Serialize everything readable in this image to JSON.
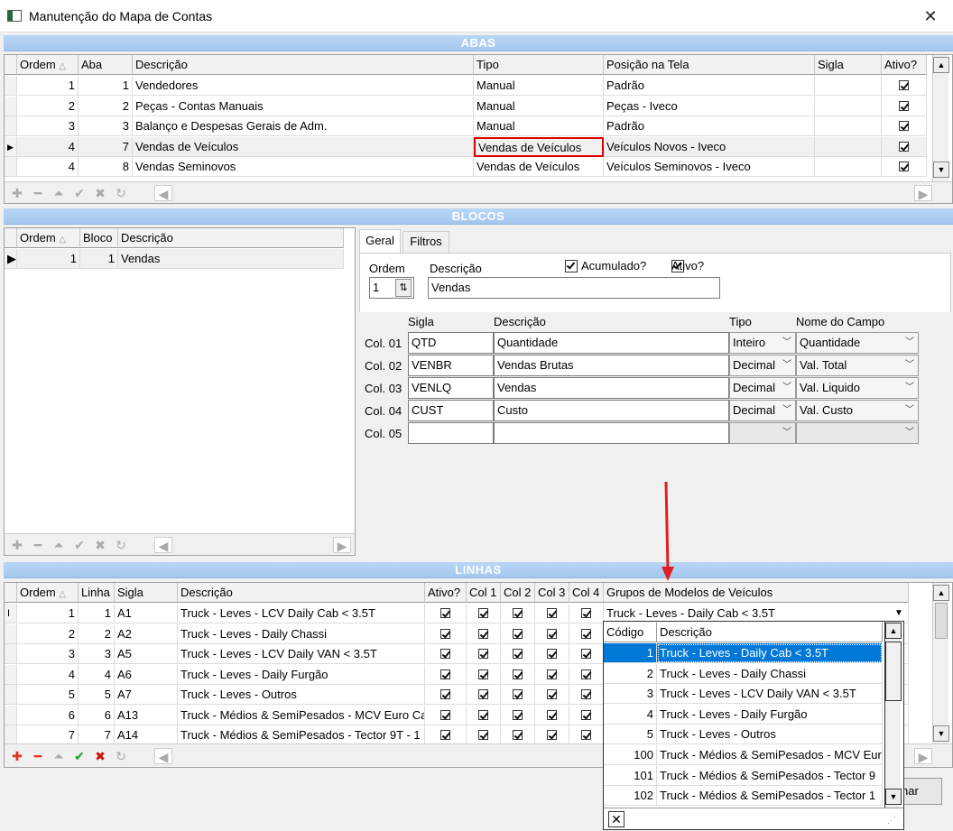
{
  "window": {
    "title": "Manutenção do Mapa de Contas"
  },
  "abas": {
    "title": "ABAS",
    "headers": [
      "Ordem",
      "Aba",
      "Descrição",
      "Tipo",
      "Posição na Tela",
      "Sigla",
      "Ativo?"
    ],
    "rows": [
      {
        "ordem": "1",
        "aba": "1",
        "desc": "Vendedores",
        "tipo": "Manual",
        "pos": "Padrão",
        "sigla": ""
      },
      {
        "ordem": "2",
        "aba": "2",
        "desc": "Peças - Contas Manuais",
        "tipo": "Manual",
        "pos": "Peças - Iveco",
        "sigla": ""
      },
      {
        "ordem": "3",
        "aba": "3",
        "desc": "Balanço e Despesas Gerais de Adm.",
        "tipo": "Manual",
        "pos": "Padrão",
        "sigla": ""
      },
      {
        "ordem": "4",
        "aba": "7",
        "desc": "Vendas de Veículos",
        "tipo": "Vendas de Veículos",
        "pos": "Veículos Novos - Iveco",
        "sigla": ""
      },
      {
        "ordem": "4",
        "aba": "8",
        "desc": "Vendas Seminovos",
        "tipo": "Vendas de Veículos",
        "pos": "Veículos Seminovos - Iveco",
        "sigla": ""
      }
    ]
  },
  "blocos": {
    "title": "BLOCOS",
    "headers": [
      "Ordem",
      "Bloco",
      "Descrição"
    ],
    "rows": [
      {
        "ordem": "1",
        "bloco": "1",
        "desc": "Vendas"
      }
    ]
  },
  "form": {
    "tabs": [
      "Geral",
      "Filtros"
    ],
    "ordem_label": "Ordem",
    "ordem_value": "1",
    "descricao_label": "Descrição",
    "descricao_value": "Vendas",
    "acumulado_label": "Acumulado?",
    "ativo_label": "Ativo?",
    "col_headers": [
      "Sigla",
      "Descrição",
      "Tipo",
      "Nome do Campo"
    ],
    "cols": [
      {
        "label": "Col. 01",
        "sigla": "QTD",
        "desc": "Quantidade",
        "tipo": "Inteiro",
        "campo": "Quantidade"
      },
      {
        "label": "Col. 02",
        "sigla": "VENBR",
        "desc": "Vendas Brutas",
        "tipo": "Decimal",
        "campo": "Val. Total"
      },
      {
        "label": "Col. 03",
        "sigla": "VENLQ",
        "desc": "Vendas",
        "tipo": "Decimal",
        "campo": "Val. Liquido"
      },
      {
        "label": "Col. 04",
        "sigla": "CUST",
        "desc": "Custo",
        "tipo": "Decimal",
        "campo": "Val. Custo"
      },
      {
        "label": "Col. 05",
        "sigla": "",
        "desc": "",
        "tipo": "",
        "campo": ""
      }
    ]
  },
  "linhas": {
    "title": "LINHAS",
    "headers": [
      "Ordem",
      "Linha",
      "Sigla",
      "Descrição",
      "Ativo?",
      "Col 1",
      "Col 2",
      "Col 3",
      "Col 4",
      "Grupos de Modelos de Veículos"
    ],
    "rows": [
      {
        "ordem": "1",
        "linha": "1",
        "sigla": "A1",
        "desc": "Truck - Leves - LCV Daily Cab < 3.5T",
        "grupo": "Truck - Leves - Daily Cab < 3.5T"
      },
      {
        "ordem": "2",
        "linha": "2",
        "sigla": "A2",
        "desc": "Truck - Leves - Daily Chassi",
        "grupo": ""
      },
      {
        "ordem": "3",
        "linha": "3",
        "sigla": "A5",
        "desc": "Truck - Leves - LCV Daily VAN < 3.5T",
        "grupo": ""
      },
      {
        "ordem": "4",
        "linha": "4",
        "sigla": "A6",
        "desc": "Truck - Leves - Daily Furgão",
        "grupo": ""
      },
      {
        "ordem": "5",
        "linha": "5",
        "sigla": "A7",
        "desc": "Truck - Leves - Outros",
        "grupo": ""
      },
      {
        "ordem": "6",
        "linha": "6",
        "sigla": "A13",
        "desc": "Truck - Médios & SemiPesados - MCV Euro Ca",
        "grupo": ""
      },
      {
        "ordem": "7",
        "linha": "7",
        "sigla": "A14",
        "desc": "Truck - Médios & SemiPesados - Tector 9T - 1",
        "grupo": ""
      }
    ]
  },
  "dropdown": {
    "headers": [
      "Código",
      "Descrição"
    ],
    "rows": [
      {
        "code": "1",
        "desc": "Truck - Leves - Daily Cab < 3.5T"
      },
      {
        "code": "2",
        "desc": "Truck - Leves - Daily Chassi"
      },
      {
        "code": "3",
        "desc": "Truck - Leves - LCV Daily VAN < 3.5T"
      },
      {
        "code": "4",
        "desc": "Truck - Leves - Daily Furgão"
      },
      {
        "code": "5",
        "desc": "Truck - Leves - Outros"
      },
      {
        "code": "100",
        "desc": "Truck - Médios & SemiPesados - MCV Euro"
      },
      {
        "code": "101",
        "desc": "Truck - Médios & SemiPesados - Tector 9"
      },
      {
        "code": "102",
        "desc": "Truck - Médios & SemiPesados - Tector 1"
      }
    ]
  },
  "footer": {
    "button_partial": "nar"
  },
  "colors": {
    "section_bar": "#a4c7ef",
    "highlight_border": "#e00000",
    "selection": "#0078d7",
    "arrow": "#e02020"
  }
}
